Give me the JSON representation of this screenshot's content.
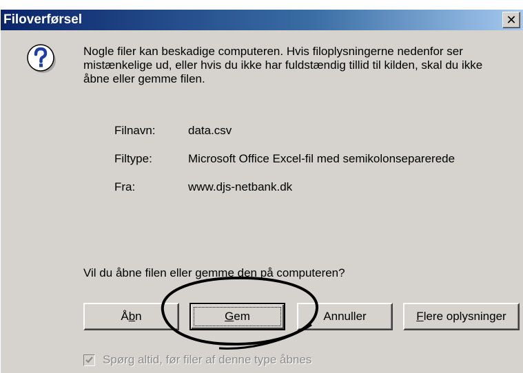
{
  "window": {
    "title": "Filoverførsel",
    "close_label": "✕"
  },
  "message": "Nogle filer kan beskadige computeren. Hvis filoplysningerne nedenfor ser mistænkelige ud, eller hvis du ikke har fuldstændig tillid til kilden, skal du ikke åbne eller gemme filen.",
  "file_info": {
    "name_label": "Filnavn:",
    "name_value": "data.csv",
    "type_label": "Filtype:",
    "type_value": "Microsoft Office Excel-fil med semikolonseparerede",
    "from_label": "Fra:",
    "from_value": "www.djs-netbank.dk"
  },
  "question": "Vil du åbne filen eller gemme den på computeren?",
  "buttons": {
    "open_prefix": "Å",
    "open_hotkey": "b",
    "open_suffix": "n",
    "save_hotkey": "G",
    "save_suffix": "em",
    "cancel": "Annuller",
    "more_hotkey": "F",
    "more_suffix": "lere oplysninger"
  },
  "checkbox": {
    "label": "Spørg altid, før filer af denne type åbnes",
    "checked": true
  },
  "annotation": {
    "type": "hand-drawn ellipse",
    "target": "save-button",
    "color": "#000000"
  },
  "colors": {
    "dialog_bg": "#d6d3ce",
    "title_gradient_start": "#0a246a",
    "title_gradient_end": "#a6caf0",
    "icon_blue": "#1c3ea8"
  }
}
